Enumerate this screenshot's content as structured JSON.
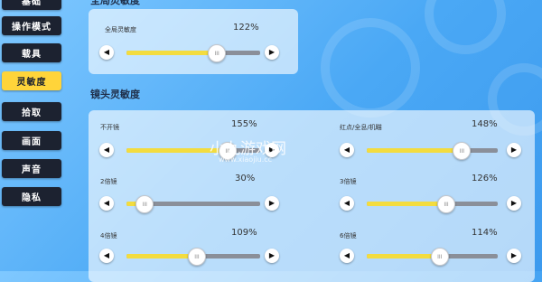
{
  "sidebar": {
    "items": [
      {
        "label": "基础"
      },
      {
        "label": "操作模式"
      },
      {
        "label": "载具"
      },
      {
        "label": "灵敏度",
        "active": true
      },
      {
        "label": "拾取"
      },
      {
        "label": "画面"
      },
      {
        "label": "声音"
      },
      {
        "label": "隐私"
      }
    ]
  },
  "top_section": {
    "title": "全局灵敏度",
    "slider": {
      "label": "全局灵敏度",
      "value_text": "122%",
      "level_percent": 67
    }
  },
  "lens_section": {
    "title": "镜头灵敏度",
    "sliders": [
      {
        "label": "不开镜",
        "value_text": "155%",
        "level_percent": 75
      },
      {
        "label": "红点/全息/机瞄",
        "value_text": "148%",
        "level_percent": 72
      },
      {
        "label": "2倍镜",
        "value_text": "30%",
        "level_percent": 13
      },
      {
        "label": "3倍镜",
        "value_text": "126%",
        "level_percent": 60
      },
      {
        "label": "4倍镜",
        "value_text": "109%",
        "level_percent": 52
      },
      {
        "label": "6倍镜",
        "value_text": "114%",
        "level_percent": 55
      }
    ]
  },
  "controls": {
    "decrease_symbol": "◀",
    "increase_symbol": "▶",
    "knob_symbol": "III"
  },
  "watermark": {
    "text": "小九游戏网",
    "url": "www.xiaojiu.cc"
  },
  "colors": {
    "accent": "#ffd43a",
    "slider_fill": "#f3dc3f",
    "slider_track": "#8a8f99",
    "sidebar_bg": "#1c2230"
  }
}
